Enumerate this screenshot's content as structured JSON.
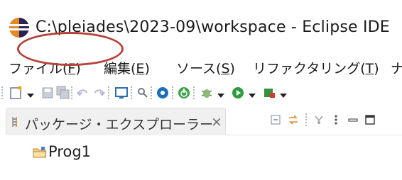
{
  "window": {
    "title": "C:\\pleiades\\2023-09\\workspace - Eclipse IDE",
    "icon": "eclipse-logo-icon"
  },
  "menubar": {
    "items": [
      {
        "label": "ファイル(",
        "mnemonic": "F",
        "close": ")"
      },
      {
        "label": "編集(",
        "mnemonic": "E",
        "close": ")"
      },
      {
        "label": "ソース(",
        "mnemonic": "S",
        "close": ")"
      },
      {
        "label": "リファクタリング(",
        "mnemonic": "T",
        "close": ")"
      },
      {
        "label": "ナ",
        "mnemonic": "",
        "close": ""
      }
    ]
  },
  "toolbar": {
    "icons": [
      "new-wizard-icon",
      "save-icon",
      "save-all-icon",
      "undo-icon",
      "redo-icon",
      "console-icon",
      "search-icon",
      "settings-icon",
      "power-icon",
      "debug-icon",
      "run-icon",
      "external-tools-icon"
    ]
  },
  "view": {
    "tab_label": "パッケージ・エクスプローラー",
    "tab_close": "×",
    "tab_icon": "package-explorer-icon",
    "toolbar_icons": [
      "collapse-all-icon",
      "link-with-editor-icon",
      "view-menu-icon",
      "kebab-icon",
      "minimize-icon",
      "maximize-icon"
    ]
  },
  "tree": {
    "items": [
      {
        "label": "Prog1",
        "icon": "project-folder-icon"
      }
    ]
  },
  "annotation": {
    "color": "#b5423b"
  }
}
